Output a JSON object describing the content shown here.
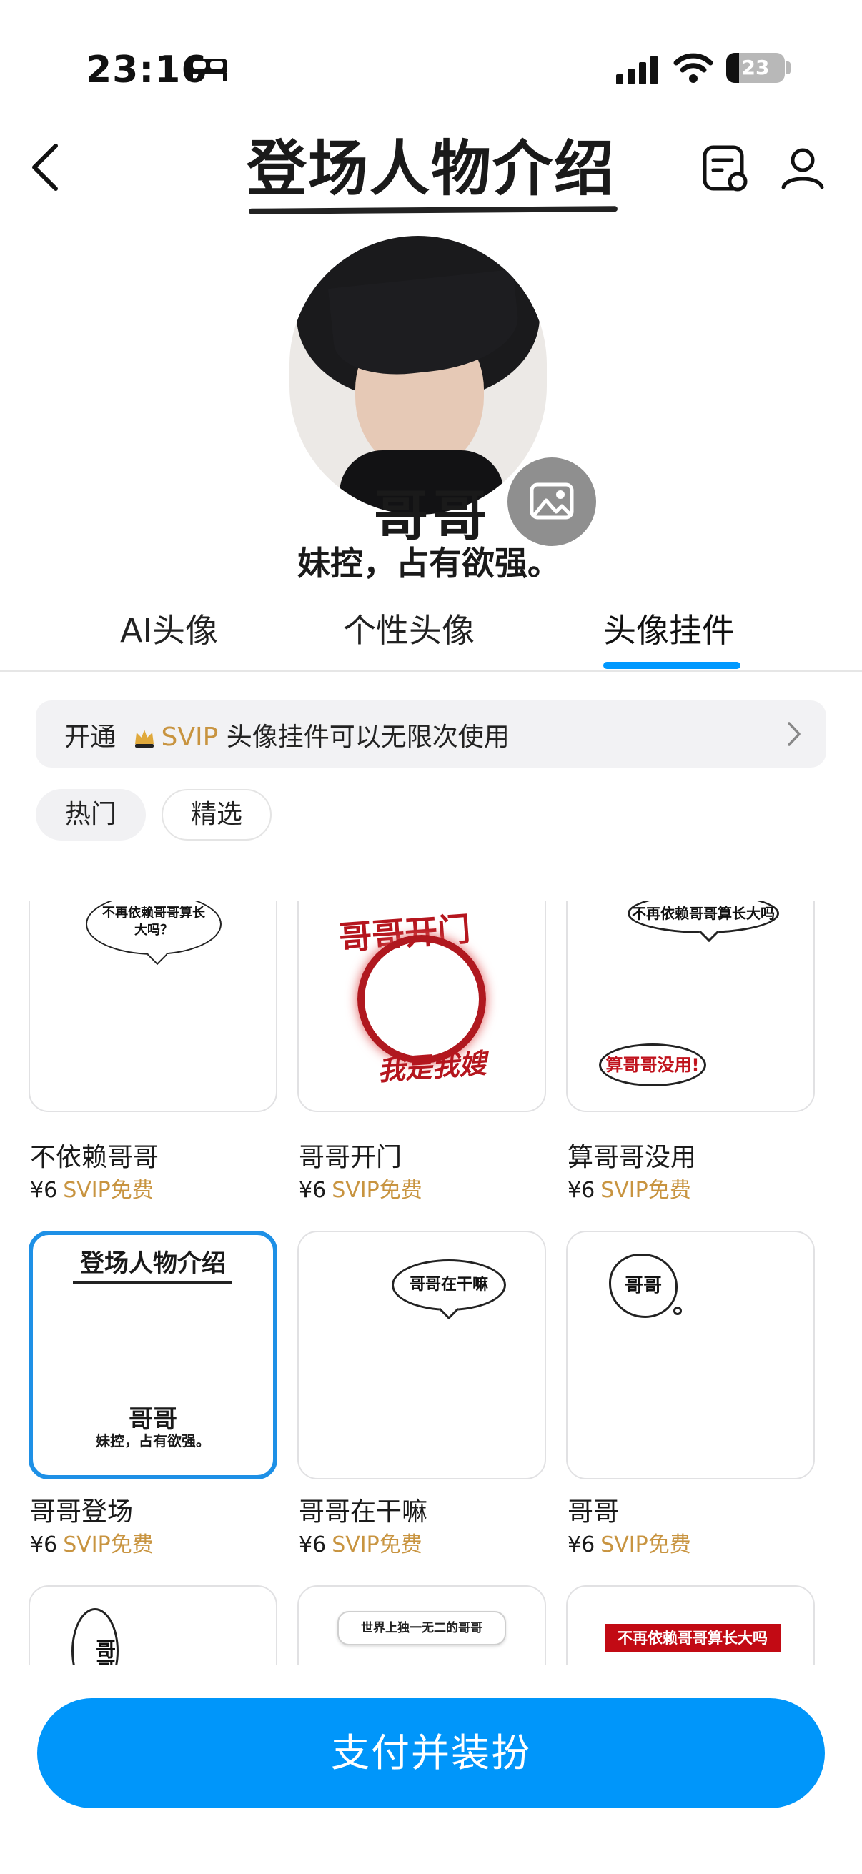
{
  "status_bar": {
    "time": "23:16",
    "battery": "23"
  },
  "header": {
    "title": "登场人物介绍"
  },
  "profile": {
    "name": "哥哥",
    "subtitle": "妹控，占有欲强。"
  },
  "tabs": [
    {
      "label": "AI头像"
    },
    {
      "label": "个性头像"
    },
    {
      "label": "头像挂件",
      "active": true
    }
  ],
  "promo": {
    "prefix": "开通",
    "svip": "SVIP",
    "suffix": "头像挂件可以无限次使用"
  },
  "filters": [
    {
      "label": "热门",
      "active": true
    },
    {
      "label": "精选"
    }
  ],
  "items": [
    {
      "name": "不依赖哥哥",
      "price": "¥6",
      "svip": "SVIP免费",
      "art_text": "不再依赖哥哥算长大吗？"
    },
    {
      "name": "哥哥开门",
      "price": "¥6",
      "svip": "SVIP免费",
      "art_top": "哥哥开门",
      "art_bottom": "我是我嫂"
    },
    {
      "name": "算哥哥没用",
      "price": "¥6",
      "svip": "SVIP免费",
      "art_top": "不再依赖哥哥算长大吗",
      "art_bottom": "算哥哥没用!"
    },
    {
      "name": "哥哥登场",
      "price": "¥6",
      "svip": "SVIP免费",
      "selected": true,
      "art_top": "登场人物介绍",
      "art_name": "哥哥",
      "art_sub": "妹控，占有欲强。"
    },
    {
      "name": "哥哥在干嘛",
      "price": "¥6",
      "svip": "SVIP免费",
      "art_text": "哥哥在干嘛"
    },
    {
      "name": "哥哥",
      "price": "¥6",
      "svip": "SVIP免费",
      "art_text": "哥哥"
    },
    {
      "art_text": "哥哥"
    },
    {
      "art_text": "世界上独一无二的哥哥"
    },
    {
      "art_text": "不再依赖哥哥算长大吗"
    }
  ],
  "pay_button": "支付并装扮",
  "colors": {
    "accent": "#0096fa",
    "svip": "#c89440",
    "selected_border": "#1e90e6"
  },
  "icons": [
    "back-icon",
    "history-icon",
    "profile-icon",
    "image-icon",
    "crown-icon",
    "chevron-right-icon"
  ]
}
